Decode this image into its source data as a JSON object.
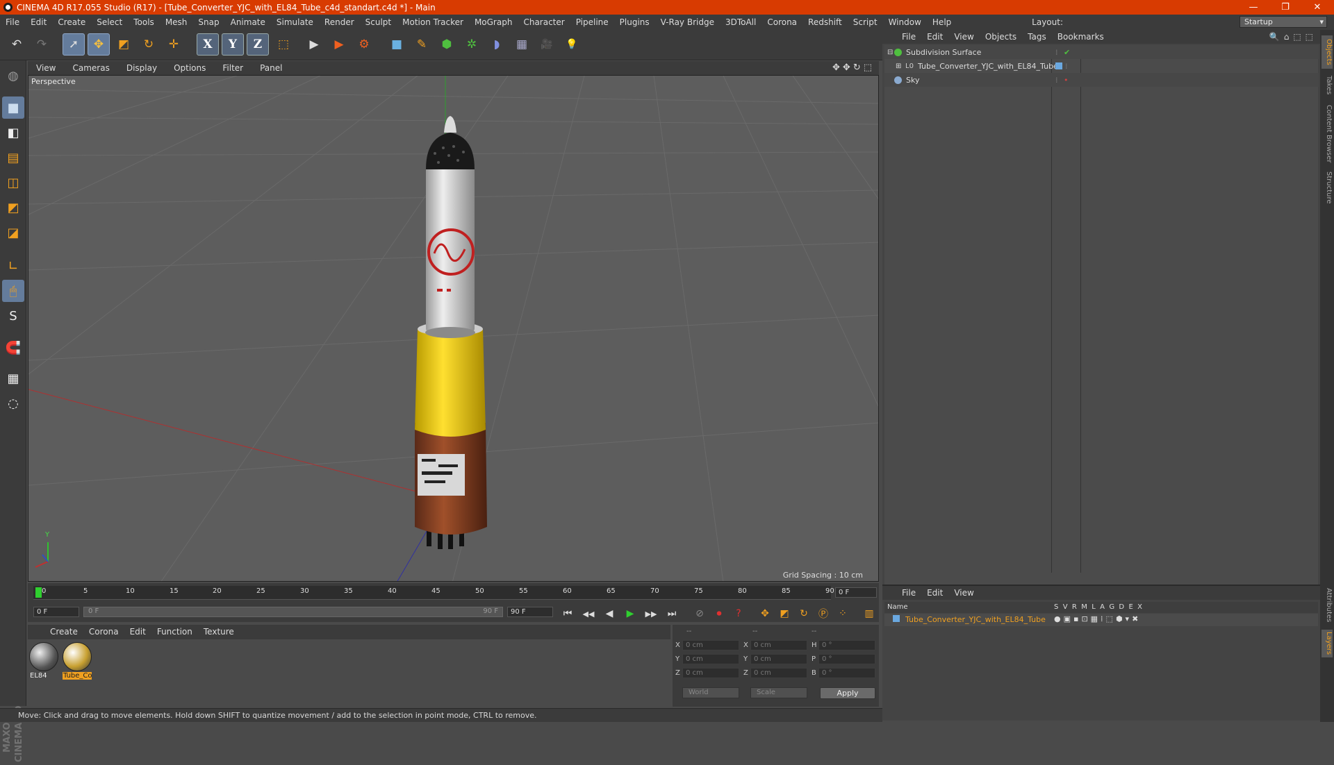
{
  "window": {
    "title": "CINEMA 4D R17.055 Studio (R17) - [Tube_Converter_YJC_with_EL84_Tube_c4d_standart.c4d *] - Main",
    "minimize": "—",
    "restore": "❐",
    "close": "✕"
  },
  "menu": [
    "File",
    "Edit",
    "Create",
    "Select",
    "Tools",
    "Mesh",
    "Snap",
    "Animate",
    "Simulate",
    "Render",
    "Sculpt",
    "Motion Tracker",
    "MoGraph",
    "Character",
    "Pipeline",
    "Plugins",
    "V-Ray Bridge",
    "3DToAll",
    "Corona",
    "Redshift",
    "Script",
    "Window",
    "Help"
  ],
  "layout": {
    "label": "Layout:",
    "value": "Startup"
  },
  "toolbar": {
    "undo": "↶",
    "redo": "↷",
    "select": "➚",
    "move": "✥",
    "scale": "◩",
    "rotate": "↻",
    "add": "✛",
    "axis_x": "X",
    "axis_y": "Y",
    "axis_z": "Z",
    "coord": "⬚",
    "render_view": "▶",
    "render_pv": "▶",
    "render_settings": "⚙",
    "cube": "■",
    "pen": "✎",
    "subdiv": "⬢",
    "array": "✲",
    "deform": "◗",
    "floor": "▦",
    "camera": "🎥",
    "light": "💡"
  },
  "lefttools": [
    "■",
    "◧",
    "▤",
    "◫",
    "◩",
    "◪",
    "∟",
    "🖱",
    "S",
    "🧲",
    "▦",
    "◌"
  ],
  "maxon": "MAXON CINEMA 4D",
  "viewport": {
    "menu": [
      "View",
      "Cameras",
      "Display",
      "Options",
      "Filter",
      "Panel"
    ],
    "icons": "✥✥↻⬚",
    "name": "Perspective",
    "grid_spacing": "Grid Spacing : 10 cm",
    "axis_y": "Y"
  },
  "objects_manager": {
    "menu": [
      "File",
      "Edit",
      "View",
      "Objects",
      "Tags",
      "Bookmarks"
    ],
    "icons": "🔍⌂⬚⬚",
    "items": [
      {
        "name": "Subdivision Surface",
        "check": "✔",
        "icon_color": "#4fbf3f"
      },
      {
        "name": "Tube_Converter_YJC_with_EL84_Tube",
        "icon_color": "#9fbfe0"
      },
      {
        "name": "Sky",
        "icon_color": "#8aaad0"
      }
    ]
  },
  "side_tabs": [
    "Objects",
    "Takes",
    "Content Browser",
    "Structure"
  ],
  "side_tabs_bottom": [
    "Attributes",
    "Layers"
  ],
  "layers_manager": {
    "menu": [
      "File",
      "Edit",
      "View"
    ],
    "name_header": "Name",
    "columns": "S  V  R  M  L  A  G  D  E  X",
    "row_name": "Tube_Converter_YJC_with_EL84_Tube"
  },
  "timeline": {
    "ticks": [
      "0",
      "5",
      "10",
      "15",
      "20",
      "25",
      "30",
      "35",
      "40",
      "45",
      "50",
      "55",
      "60",
      "65",
      "70",
      "75",
      "80",
      "85",
      "90"
    ],
    "current_frame": "0 F",
    "start": "0 F",
    "range_start": "0 F",
    "range_end": "90 F",
    "end": "90 F",
    "buttons": [
      "⏮",
      "◀◀",
      "◀",
      "▶",
      "▶▶",
      "⏭"
    ]
  },
  "material_manager": {
    "menu": [
      "Create",
      "Corona",
      "Edit",
      "Function",
      "Texture"
    ],
    "materials": [
      {
        "name": "EL84"
      },
      {
        "name": "Tube_Co"
      }
    ]
  },
  "coordinates": {
    "header": [
      "--",
      "--",
      "--"
    ],
    "rows": [
      {
        "l1": "X",
        "v1": "0 cm",
        "l2": "X",
        "v2": "0 cm",
        "l3": "H",
        "v3": "0 °"
      },
      {
        "l1": "Y",
        "v1": "0 cm",
        "l2": "Y",
        "v2": "0 cm",
        "l3": "P",
        "v3": "0 °"
      },
      {
        "l1": "Z",
        "v1": "0 cm",
        "l2": "Z",
        "v2": "0 cm",
        "l3": "B",
        "v3": "0 °"
      }
    ],
    "mode": "World",
    "transform": "Scale",
    "apply": "Apply"
  },
  "status": "Move: Click and drag to move elements. Hold down SHIFT to quantize movement / add to the selection in point mode, CTRL to remove."
}
